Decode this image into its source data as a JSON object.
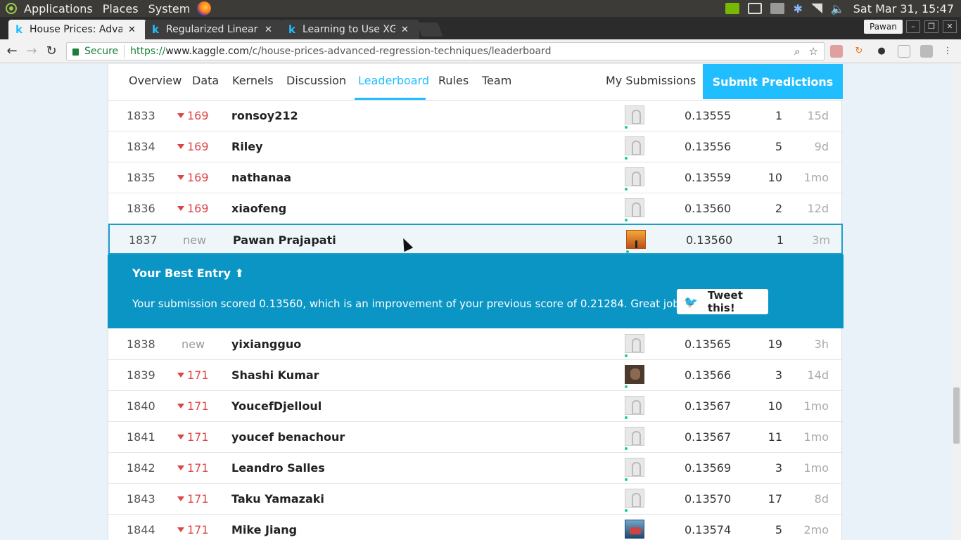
{
  "panel": {
    "menus": [
      "Applications",
      "Places",
      "System"
    ],
    "clock": "Sat Mar 31, 15:47"
  },
  "browser": {
    "tabs": [
      {
        "title": "House Prices: Adva",
        "favicon": "k"
      },
      {
        "title": "Regularized Linear ",
        "favicon": "k"
      },
      {
        "title": "Learning to Use XG",
        "favicon": "k"
      }
    ],
    "profile": "Pawan",
    "secure_label": "Secure",
    "url": {
      "proto": "https://",
      "host": "www.kaggle.com",
      "path": "/c/house-prices-advanced-regression-techniques/leaderboard"
    }
  },
  "subnav": {
    "items": [
      "Overview",
      "Data",
      "Kernels",
      "Discussion",
      "Leaderboard",
      "Rules",
      "Team"
    ],
    "active": "Leaderboard",
    "my_submissions": "My Submissions",
    "submit": "Submit Predictions"
  },
  "leaderboard": {
    "rows": [
      {
        "rank": "1833",
        "delta": "169",
        "name": "ronsoy212",
        "avatar": "default",
        "score": "0.13555",
        "entries": "1",
        "last": "15d"
      },
      {
        "rank": "1834",
        "delta": "169",
        "name": "Riley",
        "avatar": "default",
        "score": "0.13556",
        "entries": "5",
        "last": "9d"
      },
      {
        "rank": "1835",
        "delta": "169",
        "name": "nathanaa",
        "avatar": "default",
        "score": "0.13559",
        "entries": "10",
        "last": "1mo"
      },
      {
        "rank": "1836",
        "delta": "169",
        "name": "xiaofeng",
        "avatar": "default",
        "score": "0.13560",
        "entries": "2",
        "last": "12d"
      },
      {
        "rank": "1837",
        "delta": "new",
        "name": "Pawan Prajapati",
        "avatar": "sunset",
        "score": "0.13560",
        "entries": "1",
        "last": "3m"
      },
      {
        "rank": "1838",
        "delta": "new",
        "name": "yixiangguo",
        "avatar": "default",
        "score": "0.13565",
        "entries": "19",
        "last": "3h"
      },
      {
        "rank": "1839",
        "delta": "171",
        "name": "Shashi Kumar",
        "avatar": "person",
        "score": "0.13566",
        "entries": "3",
        "last": "14d"
      },
      {
        "rank": "1840",
        "delta": "171",
        "name": "YoucefDjelloul",
        "avatar": "default",
        "score": "0.13567",
        "entries": "10",
        "last": "1mo"
      },
      {
        "rank": "1841",
        "delta": "171",
        "name": "youcef benachour",
        "avatar": "default",
        "score": "0.13567",
        "entries": "11",
        "last": "1mo"
      },
      {
        "rank": "1842",
        "delta": "171",
        "name": "Leandro Salles",
        "avatar": "default",
        "score": "0.13569",
        "entries": "3",
        "last": "1mo"
      },
      {
        "rank": "1843",
        "delta": "171",
        "name": "Taku Yamazaki",
        "avatar": "default",
        "score": "0.13570",
        "entries": "17",
        "last": "8d"
      },
      {
        "rank": "1844",
        "delta": "171",
        "name": "Mike Jiang",
        "avatar": "blue",
        "score": "0.13574",
        "entries": "5",
        "last": "2mo"
      }
    ]
  },
  "best_entry": {
    "title": "Your Best Entry",
    "message": "Your submission scored 0.13560, which is an improvement of your previous score of 0.21284. Great job!",
    "tweet": "Tweet this!"
  },
  "colors": {
    "accent": "#20beff",
    "banner": "#0a95c4",
    "drop": "#d44444"
  }
}
